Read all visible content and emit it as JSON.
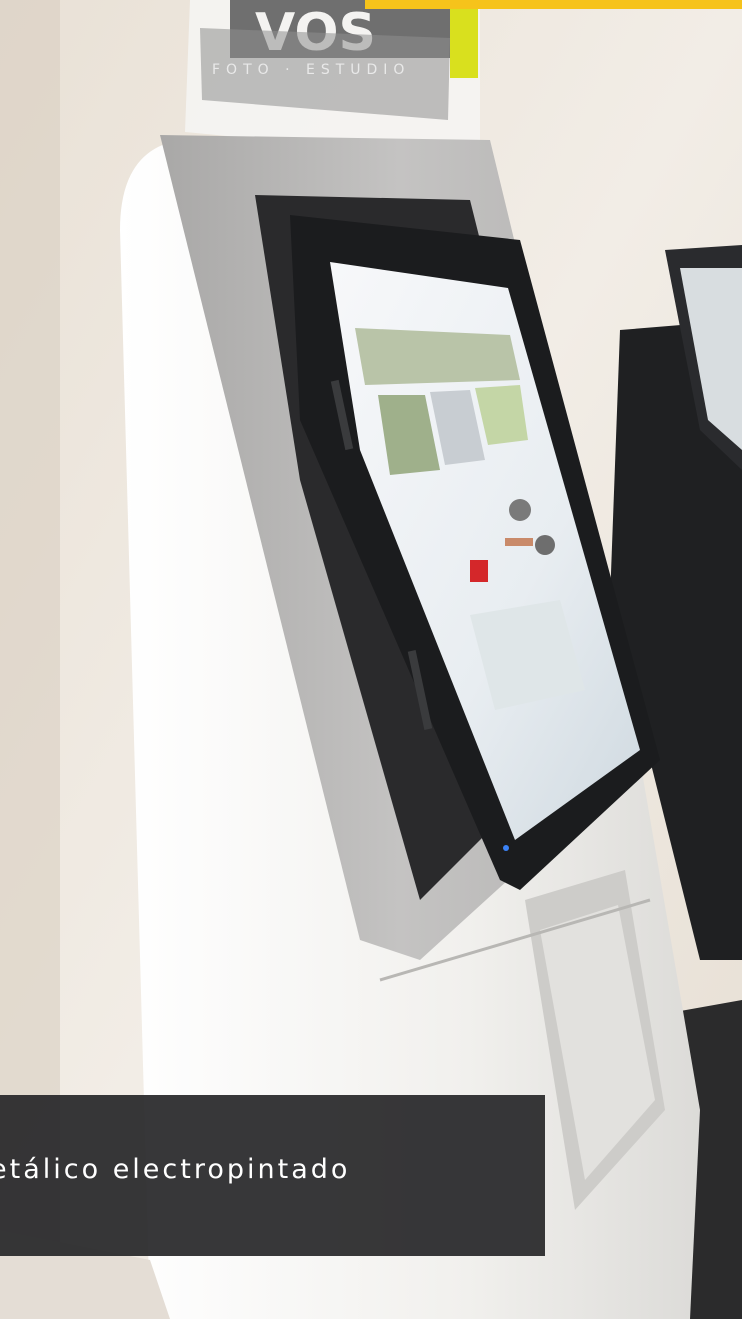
{
  "caption": {
    "text": "etálico electropintado"
  },
  "sign": {
    "logo_text": "VOS",
    "tagline": "FOTO · ESTUDIO"
  },
  "colors": {
    "accent_yellow": "#f6c31b",
    "caption_background": "#262628",
    "wall": "#efe9e1",
    "kiosk_frame": "#bdbcbb",
    "kiosk_body": "#f3f2ef"
  },
  "icons": [
    "power-led-icon"
  ]
}
